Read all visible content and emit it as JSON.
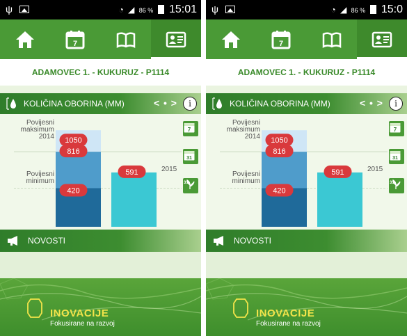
{
  "colors": {
    "accent_green": "#4a9a36",
    "bar_light": "#cfe6f6",
    "bar_mid": "#4f9ccb",
    "bar_dark": "#1f6a9a",
    "bar_2015": "#3bc8d3",
    "pill_red": "#d9393c",
    "footer_title": "#f3e44a"
  },
  "screens": [
    {
      "status": {
        "usb_icon": "usb-icon",
        "battery_pct": "86 %",
        "time": "15:01"
      },
      "nav": [
        {
          "icon": "home-icon"
        },
        {
          "icon": "calendar-7-icon"
        },
        {
          "icon": "book-icon"
        },
        {
          "icon": "user-card-icon"
        }
      ],
      "title": "ADAMOVEC 1. - KUKURUZ - P1114",
      "precip": {
        "header": "KOLIČINA OBORINA (MM)",
        "pager": "< • >",
        "info": "i"
      },
      "chart_data": {
        "type": "bar",
        "categories": [
          "2014",
          "2015"
        ],
        "series": [
          {
            "name": "maksimum",
            "values": [
              1050,
              null
            ]
          },
          {
            "name": "Povijesni maksimum",
            "values": [
              816,
              null
            ]
          },
          {
            "name": "Povijesni minimum",
            "values": [
              420,
              null
            ]
          },
          {
            "name": "2015",
            "values": [
              null,
              591
            ]
          }
        ],
        "labels": {
          "max_top": "1050",
          "max": "816",
          "min": "420",
          "current": "591"
        },
        "ylabel_max": "Povijesni\nmaksimum\n2014",
        "ylabel_min": "Povijesni\nminimum",
        "year_label": "2015",
        "ylim": [
          0,
          1150
        ]
      },
      "side_buttons": [
        {
          "icon": "calendar-7-icon",
          "text": "7"
        },
        {
          "icon": "calendar-31-icon",
          "text": "31"
        },
        {
          "icon": "plant-31-icon",
          "text": "31"
        }
      ],
      "news": {
        "header": "NOVOSTI"
      },
      "footer": {
        "title": "INOVACIJE",
        "subtitle": "Fokusirane na razvoj"
      }
    },
    {
      "status": {
        "usb_icon": "usb-icon",
        "battery_pct": "86 %",
        "time": "15:0"
      },
      "nav": [
        {
          "icon": "home-icon"
        },
        {
          "icon": "calendar-7-icon"
        },
        {
          "icon": "book-icon"
        },
        {
          "icon": "user-card-icon"
        }
      ],
      "title": "ADAMOVEC 1. - KUKURUZ - P1114",
      "precip": {
        "header": "KOLIČINA OBORINA (MM)",
        "pager": "< • >",
        "info": "i"
      },
      "chart_data": {
        "type": "bar",
        "categories": [
          "2014",
          "2015"
        ],
        "series": [
          {
            "name": "maksimum",
            "values": [
              1050,
              null
            ]
          },
          {
            "name": "Povijesni maksimum",
            "values": [
              816,
              null
            ]
          },
          {
            "name": "Povijesni minimum",
            "values": [
              420,
              null
            ]
          },
          {
            "name": "2015",
            "values": [
              null,
              591
            ]
          }
        ],
        "labels": {
          "max_top": "1050",
          "max": "816",
          "min": "420",
          "current": "591"
        },
        "ylabel_max": "Povijesni\nmaksimum\n2014",
        "ylabel_min": "Povijesni\nminimum",
        "year_label": "2015",
        "ylim": [
          0,
          1150
        ]
      },
      "side_buttons": [
        {
          "icon": "calendar-7-icon",
          "text": "7"
        },
        {
          "icon": "calendar-31-icon",
          "text": "31"
        },
        {
          "icon": "plant-31-icon",
          "text": "31"
        }
      ],
      "news": {
        "header": "NOVOSTI"
      },
      "footer": {
        "title": "INOVACIJE",
        "subtitle": "Fokusirane na razvoj"
      }
    }
  ]
}
